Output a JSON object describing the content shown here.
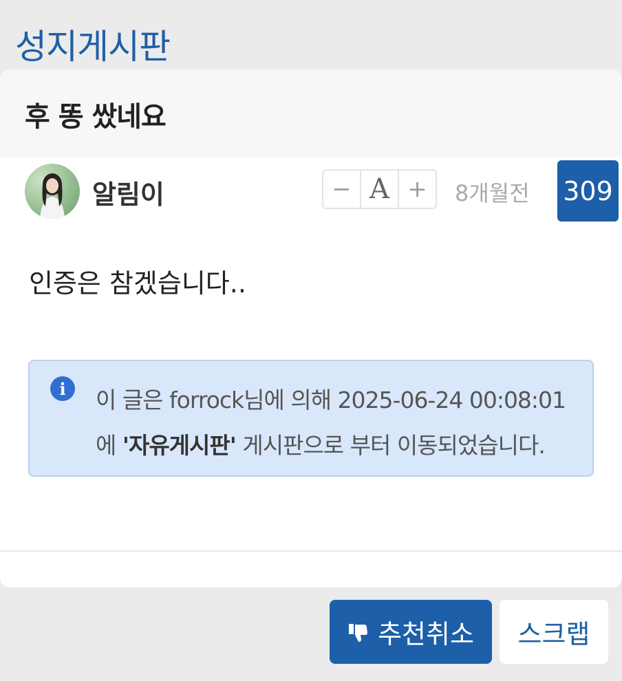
{
  "board": {
    "title": "성지게시판"
  },
  "post": {
    "title": "후 똥 쌌네요",
    "author": "알림이",
    "time_ago": "8개월전",
    "views": "309",
    "content": "인증은 참겠습니다.."
  },
  "font_controls": {
    "decrease": "−",
    "label": "A",
    "increase": "+"
  },
  "notice": {
    "prefix": "이 글은 forrock님에 의해 2025-06-24  00:08:01에 ",
    "board_name": "'자유게시판'",
    "suffix": " 게시판으로 부터 이동되었습니다."
  },
  "actions": {
    "unrecommend_label": "추천취소",
    "scrap_label": "스크랩"
  },
  "colors": {
    "accent": "#1d5fa8",
    "notice_bg": "#d9e7fb"
  },
  "icons": {
    "thumbs_down": "thumbs-down-icon",
    "info": "info-icon"
  }
}
